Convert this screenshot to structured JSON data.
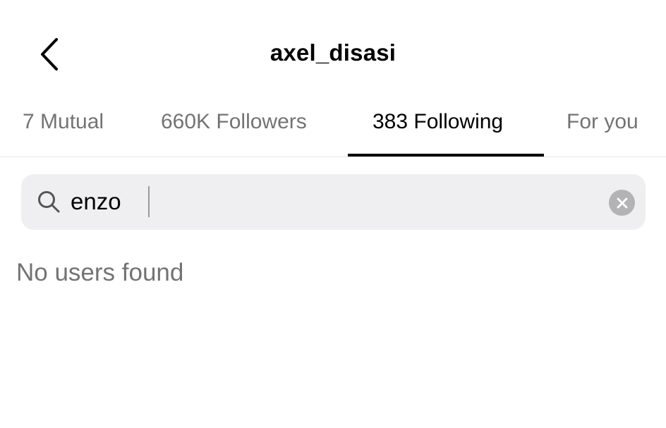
{
  "header": {
    "back_icon": "chevron-left-icon",
    "title": "axel_disasi"
  },
  "tabs": [
    {
      "label": "7 Mutual",
      "active": false
    },
    {
      "label": "660K Followers",
      "active": false
    },
    {
      "label": "383 Following",
      "active": true
    },
    {
      "label": "For you",
      "active": false
    }
  ],
  "search": {
    "icon": "search-icon",
    "value": "enzo",
    "clear_icon": "close-circle-icon"
  },
  "results": {
    "empty_message": "No users found"
  },
  "colors": {
    "text_primary": "#000000",
    "text_secondary": "#737373",
    "search_background": "#efeff1",
    "clear_button": "#b3b3b5"
  }
}
